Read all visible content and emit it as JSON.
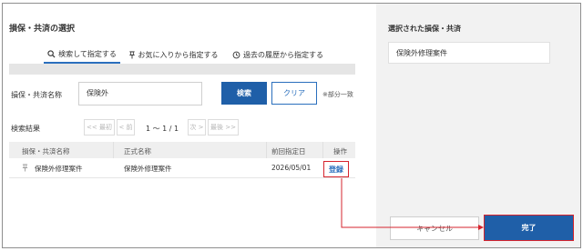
{
  "dialog": {
    "title": "損保・共済の選択",
    "tabs": [
      {
        "label": "検索して指定する",
        "icon": "search-icon",
        "active": true
      },
      {
        "label": "お気に入りから指定する",
        "icon": "pin-icon",
        "active": false
      },
      {
        "label": "過去の履歴から指定する",
        "icon": "history-icon",
        "active": false
      }
    ]
  },
  "search": {
    "label": "損保・共済名称",
    "value": "保険外",
    "search_button": "検索",
    "clear_button": "クリア",
    "note": "※部分一致"
  },
  "results": {
    "label": "検索結果",
    "pager": {
      "first": "<< 最初",
      "prev": "< 前",
      "info": "1 〜 1 / 1",
      "next": "次 >",
      "last": "最後 >>"
    },
    "columns": [
      "損保・共済名称",
      "正式名称",
      "前回指定日",
      "操作"
    ],
    "rows": [
      {
        "name": "保険外修理案件",
        "official": "保険外修理案件",
        "last_date": "2026/05/01",
        "action": "登録"
      }
    ]
  },
  "selection": {
    "title": "選択された損保・共済",
    "value": "保険外修理案件",
    "cancel_button": "キャンセル",
    "done_button": "完了"
  },
  "colors": {
    "primary": "#1f5fa8",
    "highlight": "#d6242d",
    "link": "#2a6fbd"
  }
}
